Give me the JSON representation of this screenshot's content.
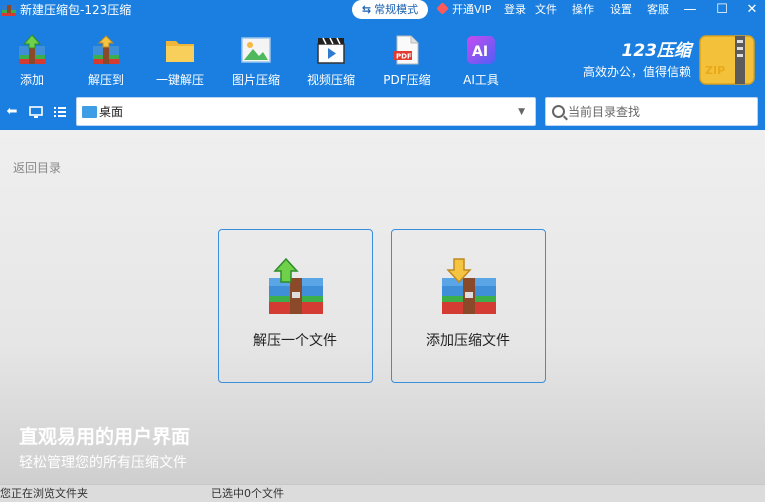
{
  "window": {
    "title": "新建压缩包-123压缩",
    "mode_label": "常规模式",
    "vip_label": "开通VIP",
    "menu": [
      "登录",
      "文件",
      "操作",
      "设置",
      "客服"
    ],
    "controls": {
      "minimize": "—",
      "maximize": "☐",
      "close": "✕"
    }
  },
  "toolbar": {
    "items": [
      {
        "label": "添加",
        "icon": "add-archive-icon"
      },
      {
        "label": "解压到",
        "icon": "extract-to-icon"
      },
      {
        "label": "一键解压",
        "icon": "folder-icon"
      },
      {
        "label": "图片压缩",
        "icon": "image-compress-icon"
      },
      {
        "label": "视频压缩",
        "icon": "video-compress-icon"
      },
      {
        "label": "PDF压缩",
        "icon": "pdf-compress-icon"
      },
      {
        "label": "AI工具",
        "icon": "ai-tool-icon"
      }
    ],
    "brand_name": "123压缩",
    "brand_slogan": "高效办公，值得信赖",
    "brand_logo_text": "ZIP"
  },
  "addressbar": {
    "path": "桌面",
    "search_placeholder": "当前目录查找"
  },
  "content": {
    "back_label": "返回目录",
    "cards": [
      {
        "label": "解压一个文件",
        "icon": "extract-box-icon"
      },
      {
        "label": "添加压缩文件",
        "icon": "add-box-icon"
      }
    ],
    "promo_title": "直观易用的用户界面",
    "promo_subtitle": "轻松管理您的所有压缩文件"
  },
  "status": {
    "left": "您正在浏览文件夹",
    "middle": "已选中0个文件"
  },
  "colors": {
    "accent": "#1a7fe0",
    "card_border": "#3a8fdc"
  }
}
